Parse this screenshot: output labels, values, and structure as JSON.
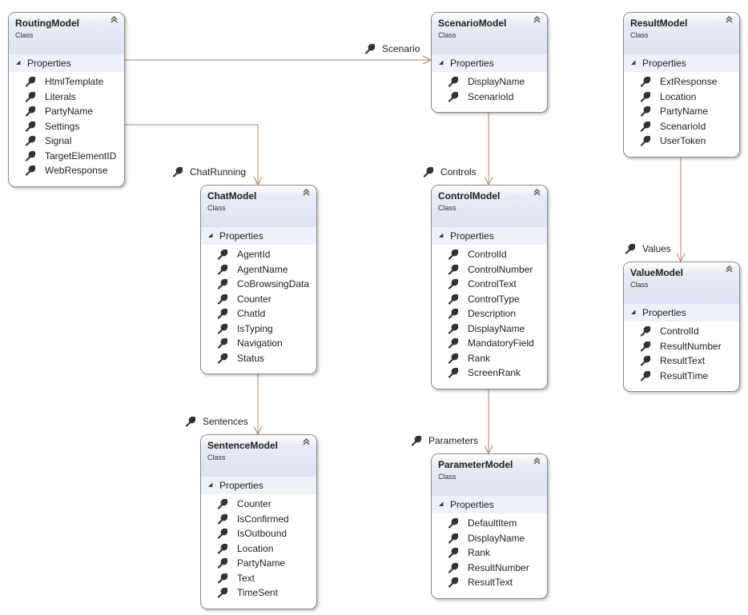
{
  "colors": {
    "connector": "#b5835f",
    "border": "#8a8a8a",
    "header": "#dde3f1"
  },
  "icons": {
    "property": "wrench-icon",
    "collapse": "double-chevron-up-icon",
    "section": "triangle-expanded-icon"
  },
  "classes": [
    {
      "name": "RoutingModel",
      "kind": "Class",
      "section": "Properties",
      "properties": [
        "HtmlTemplate",
        "Literals",
        "PartyName",
        "Settings",
        "Signal",
        "TargetElementID",
        "WebResponse"
      ]
    },
    {
      "name": "ScenarioModel",
      "kind": "Class",
      "section": "Properties",
      "properties": [
        "DisplayName",
        "ScenarioId"
      ]
    },
    {
      "name": "ResultModel",
      "kind": "Class",
      "section": "Properties",
      "properties": [
        "ExtResponse",
        "Location",
        "PartyName",
        "ScenarioId",
        "UserToken"
      ]
    },
    {
      "name": "ChatModel",
      "kind": "Class",
      "section": "Properties",
      "properties": [
        "AgentId",
        "AgentName",
        "CoBrowsingData",
        "Counter",
        "ChatId",
        "IsTyping",
        "Navigation",
        "Status"
      ]
    },
    {
      "name": "ControlModel",
      "kind": "Class",
      "section": "Properties",
      "properties": [
        "ControlId",
        "ControlNumber",
        "ControlText",
        "ControlType",
        "Description",
        "DisplayName",
        "MandatoryField",
        "Rank",
        "ScreenRank"
      ]
    },
    {
      "name": "ValueModel",
      "kind": "Class",
      "section": "Properties",
      "properties": [
        "ControlId",
        "ResultNumber",
        "ResultText",
        "ResultTime"
      ]
    },
    {
      "name": "SentenceModel",
      "kind": "Class",
      "section": "Properties",
      "properties": [
        "Counter",
        "IsConfirmed",
        "IsOutbound",
        "Location",
        "PartyName",
        "Text",
        "TimeSent"
      ]
    },
    {
      "name": "ParameterModel",
      "kind": "Class",
      "section": "Properties",
      "properties": [
        "DefaultItem",
        "DisplayName",
        "Rank",
        "ResultNumber",
        "ResultText"
      ]
    }
  ],
  "associations": [
    {
      "from": "RoutingModel",
      "to": "ScenarioModel",
      "label": "Scenario"
    },
    {
      "from": "RoutingModel",
      "to": "ChatModel",
      "label": "ChatRunning"
    },
    {
      "from": "ScenarioModel",
      "to": "ControlModel",
      "label": "Controls"
    },
    {
      "from": "ResultModel",
      "to": "ValueModel",
      "label": "Values"
    },
    {
      "from": "ChatModel",
      "to": "SentenceModel",
      "label": "Sentences"
    },
    {
      "from": "ControlModel",
      "to": "ParameterModel",
      "label": "Parameters"
    }
  ]
}
